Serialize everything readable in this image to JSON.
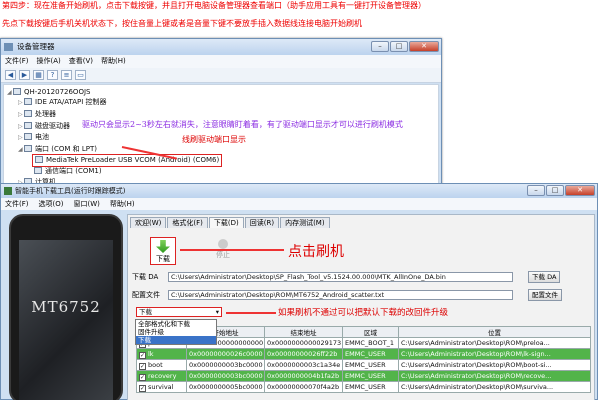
{
  "instructions": {
    "line1": "第四步：现在准备开始刷机，点击下载按键，并且打开电脑设备管理器查看端口（助手应用工具有一键打开设备管理器）",
    "line2": "先点下载按键后手机关机状态下，按住音量上键或者是音量下键不要放手插入数据线连接电脑开始刷机"
  },
  "device_manager": {
    "title": "设备管理器",
    "menu": [
      "文件(F)",
      "操作(A)",
      "查看(V)",
      "帮助(H)"
    ],
    "toolbar_icons": [
      "back-icon",
      "forward-icon",
      "grid-icon",
      "help-icon",
      "properties-icon",
      "monitor-icon"
    ],
    "tree": [
      "QH-20120726OOJS",
      "IDE ATA/ATAPI 控制器",
      "处理器",
      "磁盘驱动器",
      "电池",
      "端口 (COM 和 LPT)",
      "MediaTek PreLoader USB VCOM (Android) (COM6)",
      "通信端口 (COM1)",
      "计算机"
    ],
    "note1": "驱动只会显示2~3秒左右就消失，注意眼睛盯着看，有了驱动端口显示才可以进行刷机模式",
    "note2": "线刷驱动端口显示"
  },
  "flash_tool": {
    "title": "智能手机下载工具(运行时跟踪模式)",
    "menu": [
      "文件(F)",
      "选项(O)",
      "窗口(W)",
      "帮助(H)"
    ],
    "phone_label": "MT6752",
    "tabs": [
      "欢迎(W)",
      "格式化(F)",
      "下载(D)",
      "回读(R)",
      "内存测试(M)"
    ],
    "active_tab": "下载(D)",
    "download_btn": "下载",
    "stop_btn": "停止",
    "click_note": "点击刷机",
    "da_label": "下载 DA",
    "da_path": "C:\\Users\\Administrator\\Desktop\\SP_Flash_Tool_v5.1524.00.000\\MTK_AllInOne_DA.bin",
    "da_btn": "下载 DA",
    "scatter_label": "配置文件",
    "scatter_path": "C:\\Users\\Administrator\\Desktop\\ROM\\MT6752_Android_scatter.txt",
    "scatter_btn": "配置文件",
    "mode_value": "下载",
    "mode_note": "如果刷机不通过可以把默认下载的改回件升级",
    "mode_options": [
      "全部格式化和下载",
      "固件升级",
      "下载"
    ],
    "table_headers": [
      "名称",
      "开始地址",
      "结束地址",
      "区域",
      "位置"
    ],
    "rows": [
      {
        "name": "preloader",
        "start": "0x0000000000000000",
        "end": "0x0000000000029173",
        "region": "EMMC_BOOT_1",
        "loc": "C:\\Users\\Administrator\\Desktop\\ROM\\preloa...",
        "green": false
      },
      {
        "name": "lk",
        "start": "0x00000000026c0000",
        "end": "0x00000000026ff22b",
        "region": "EMMC_USER",
        "loc": "C:\\Users\\Administrator\\Desktop\\ROM\\lk-sign...",
        "green": true
      },
      {
        "name": "boot",
        "start": "0x0000000003bc0000",
        "end": "0x0000000003c1a34e",
        "region": "EMMC_USER",
        "loc": "C:\\Users\\Administrator\\Desktop\\ROM\\boot-si...",
        "green": false
      },
      {
        "name": "recovery",
        "start": "0x0000000003bc0000",
        "end": "0x0000000004b1fa2b",
        "region": "EMMC_USER",
        "loc": "C:\\Users\\Administrator\\Desktop\\ROM\\recove...",
        "green": true
      },
      {
        "name": "survival",
        "start": "0x0000000005bc0000",
        "end": "0x00000000070f4a2b",
        "region": "EMMC_USER",
        "loc": "C:\\Users\\Administrator\\Desktop\\ROM\\surviva...",
        "green": false
      }
    ]
  },
  "colors": {
    "note_red": "#e00000",
    "row_green": "#52b44a",
    "title_blue": "#bcd3ee"
  }
}
